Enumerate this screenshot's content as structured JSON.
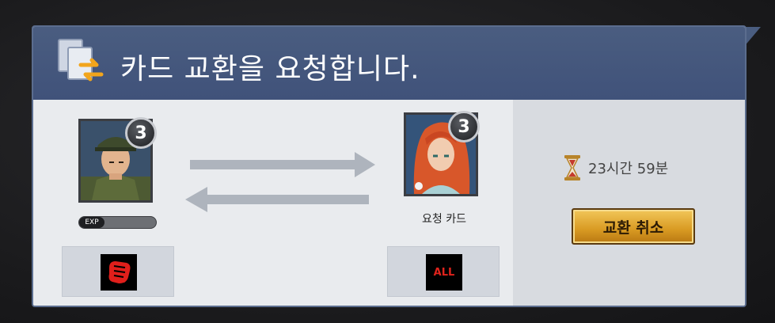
{
  "header": {
    "title": "카드 교환을 요청합니다.",
    "icon": "card-swap-icon"
  },
  "my_card": {
    "level": "3",
    "exp_label": "EXP",
    "exp_fill": 0.0,
    "slot_icon": "fist-icon"
  },
  "requested_card": {
    "level": "3",
    "label": "요청 카드",
    "slot_icon_text": "ALL"
  },
  "exchange": {
    "arrows": [
      "arrow-right-icon",
      "arrow-left-icon"
    ]
  },
  "timer": {
    "icon": "hourglass-icon",
    "text": "23시간 59분"
  },
  "cancel_button": {
    "label": "교환 취소"
  },
  "colors": {
    "header_bg": "#4a5d80",
    "button_gold": "#d89a22",
    "all_red": "#e0231c"
  }
}
